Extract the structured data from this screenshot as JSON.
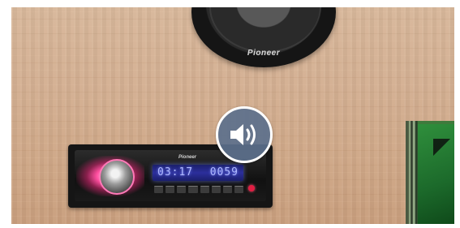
{
  "speaker": {
    "brand": "Pioneer"
  },
  "stereo": {
    "brand": "Pioneer",
    "display_left": "03:17",
    "display_right": "0059"
  },
  "overlay": {
    "icon": "speaker-volume-icon",
    "color": "#5c708c"
  }
}
